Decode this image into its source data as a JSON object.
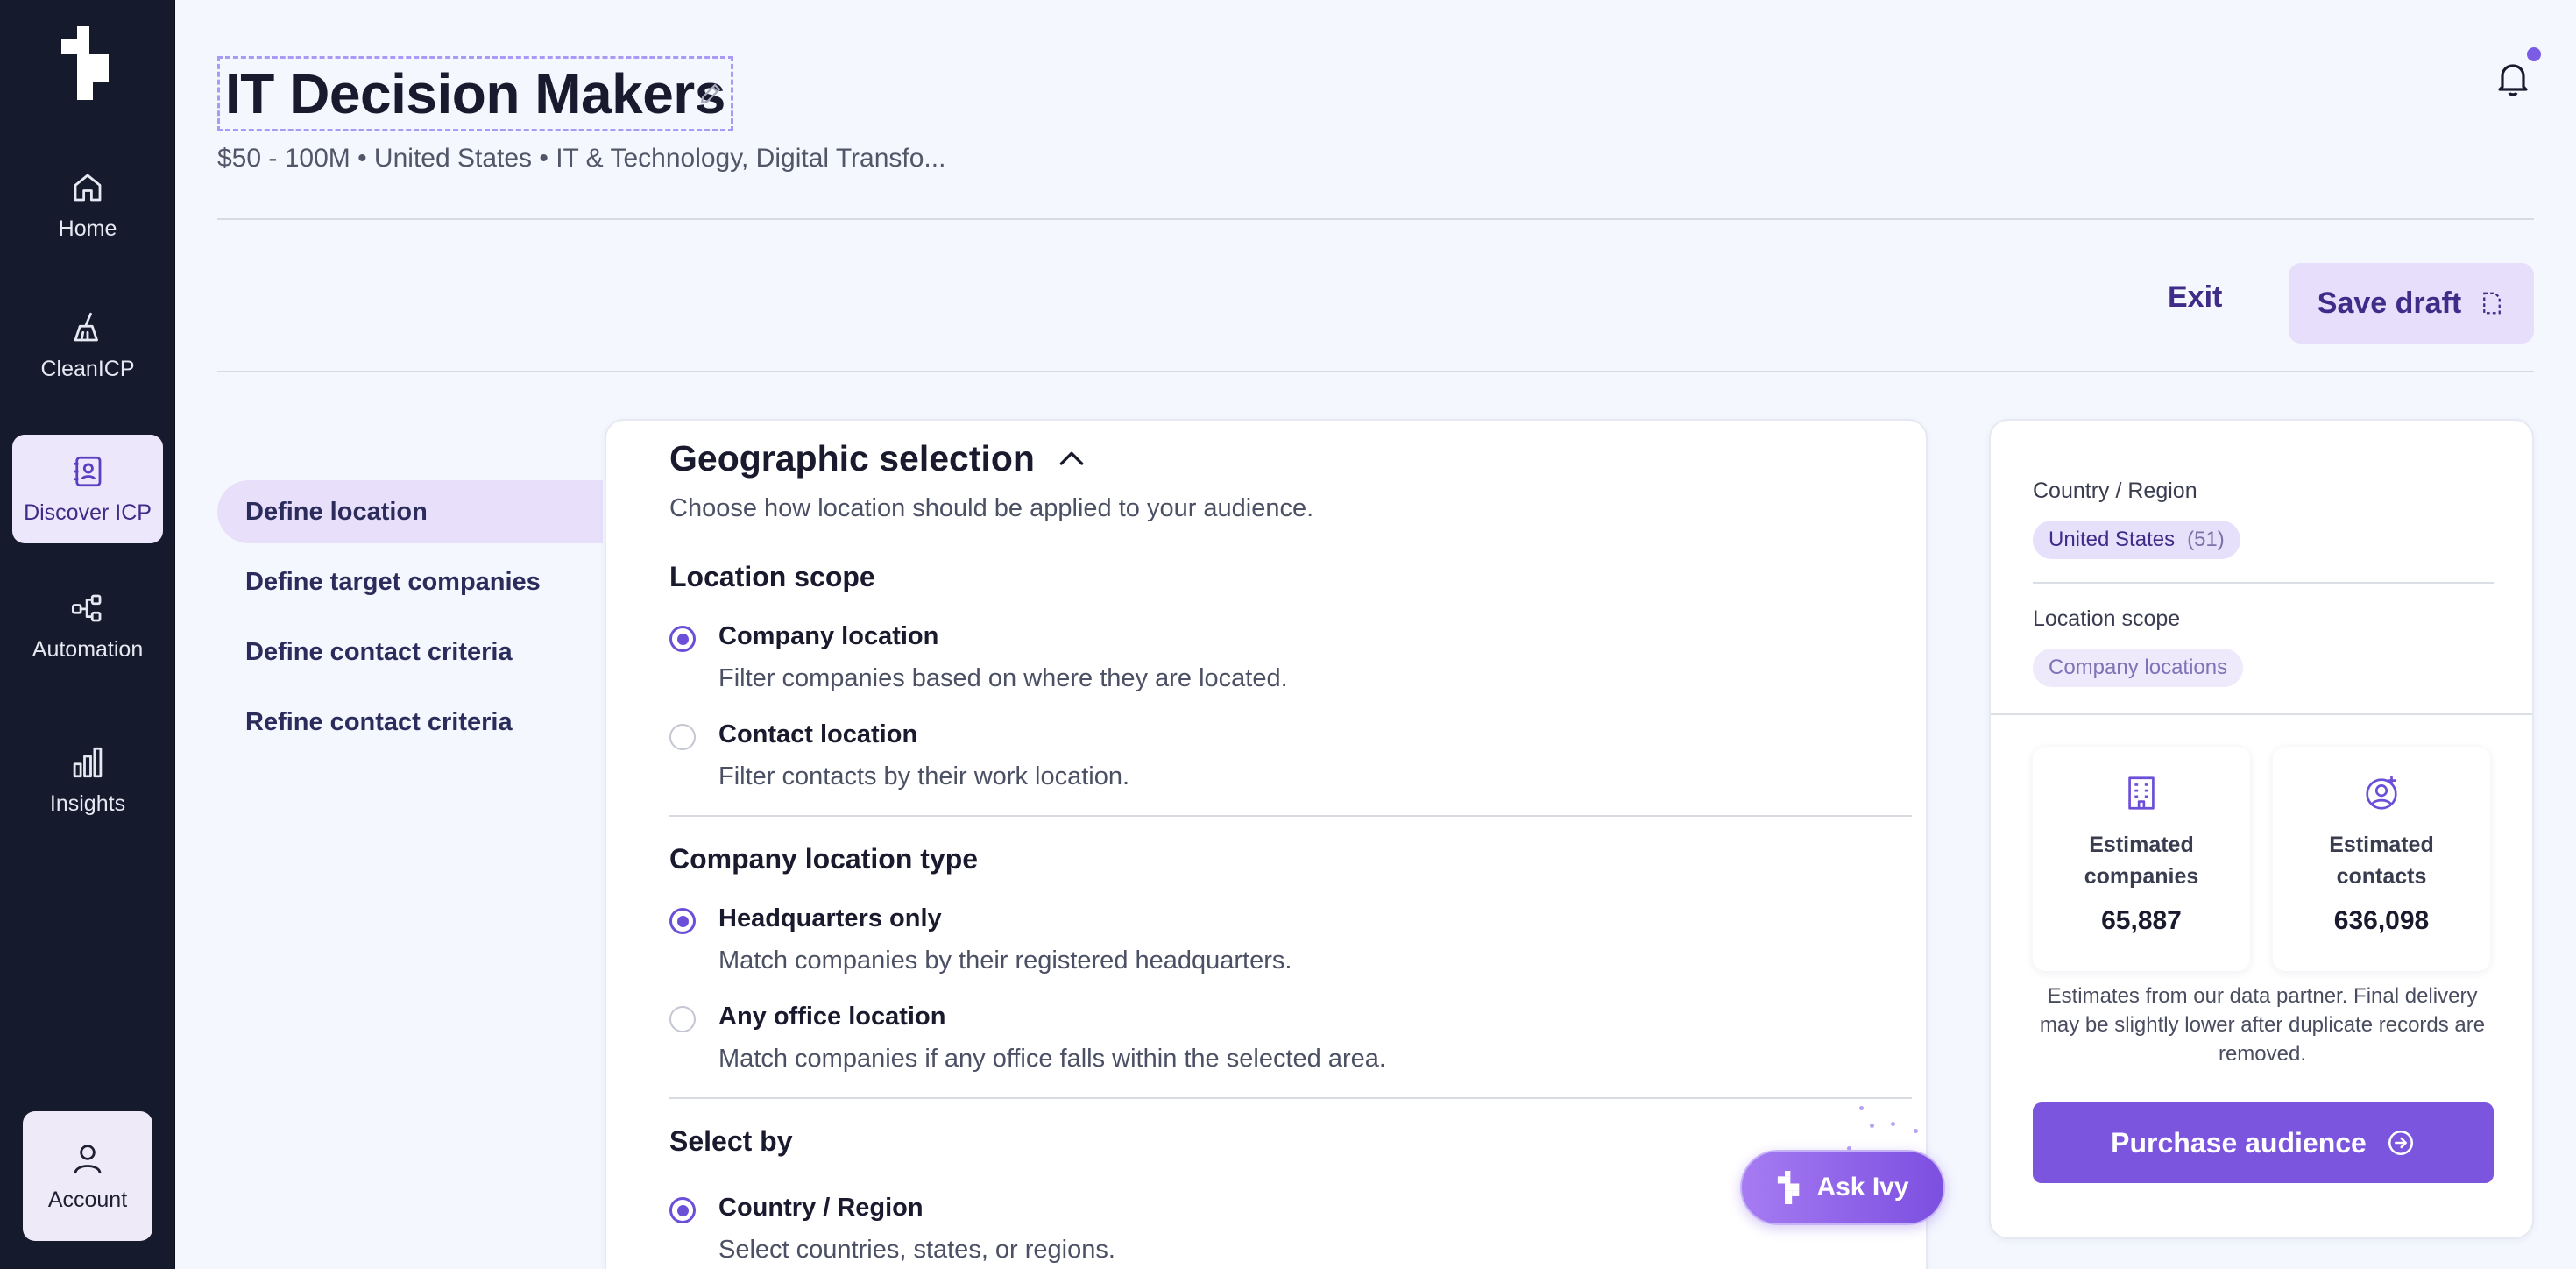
{
  "sidebar": {
    "items": [
      {
        "label": "Home",
        "icon": "home-icon"
      },
      {
        "label": "CleanICP",
        "icon": "broom-icon"
      },
      {
        "label": "Discover ICP",
        "icon": "contact-book-icon"
      },
      {
        "label": "Automation",
        "icon": "workflow-icon"
      },
      {
        "label": "Insights",
        "icon": "bar-chart-icon"
      }
    ],
    "account": {
      "label": "Account",
      "icon": "user-icon"
    },
    "active": "Discover ICP"
  },
  "header": {
    "title": "IT Decision Makers",
    "subtitle": "$50 - 100M • United States • IT & Technology, Digital Transfo..."
  },
  "actions": {
    "exit": "Exit",
    "save_draft": "Save draft"
  },
  "steps": [
    {
      "label": "Define location",
      "active": true
    },
    {
      "label": "Define target companies",
      "active": false
    },
    {
      "label": "Define contact criteria",
      "active": false
    },
    {
      "label": "Refine contact criteria",
      "active": false
    }
  ],
  "main": {
    "title": "Geographic selection",
    "description": "Choose how location should be applied to your audience.",
    "location_scope": {
      "heading": "Location scope",
      "options": [
        {
          "label": "Company location",
          "desc": "Filter companies based on where they are located.",
          "checked": true
        },
        {
          "label": "Contact location",
          "desc": "Filter contacts by their work location.",
          "checked": false
        }
      ]
    },
    "company_location_type": {
      "heading": "Company location type",
      "options": [
        {
          "label": "Headquarters only",
          "desc": "Match companies by their registered headquarters.",
          "checked": true
        },
        {
          "label": "Any office location",
          "desc": "Match companies if any office falls within the selected area.",
          "checked": false
        }
      ]
    },
    "select_by": {
      "heading": "Select by",
      "options": [
        {
          "label": "Country / Region",
          "desc": "Select countries, states, or regions.",
          "checked": true
        }
      ]
    }
  },
  "ask_ivy": {
    "label": "Ask Ivy"
  },
  "summary": {
    "country_label": "Country / Region",
    "country_chip": "United States",
    "country_count": "(51)",
    "scope_label": "Location scope",
    "scope_chip": "Company locations",
    "companies_label": "Estimated companies",
    "companies_value": "65,887",
    "contacts_label": "Estimated contacts",
    "contacts_value": "636,098",
    "note": "Estimates from our data partner. Final delivery may be slightly lower after duplicate records are removed.",
    "purchase": "Purchase audience"
  },
  "colors": {
    "sidebar_bg": "#151A2D",
    "accent": "#7B55DD",
    "accent_light": "#E6DEFA",
    "page_bg": "#F4F7FE"
  }
}
